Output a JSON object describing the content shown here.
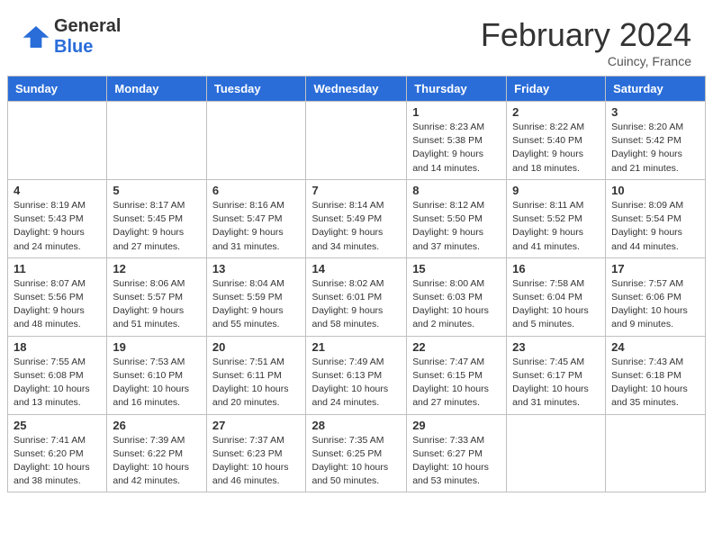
{
  "header": {
    "logo_general": "General",
    "logo_blue": "Blue",
    "month_year": "February 2024",
    "location": "Cuincy, France"
  },
  "weekdays": [
    "Sunday",
    "Monday",
    "Tuesday",
    "Wednesday",
    "Thursday",
    "Friday",
    "Saturday"
  ],
  "weeks": [
    [
      {
        "day": "",
        "info": ""
      },
      {
        "day": "",
        "info": ""
      },
      {
        "day": "",
        "info": ""
      },
      {
        "day": "",
        "info": ""
      },
      {
        "day": "1",
        "info": "Sunrise: 8:23 AM\nSunset: 5:38 PM\nDaylight: 9 hours\nand 14 minutes."
      },
      {
        "day": "2",
        "info": "Sunrise: 8:22 AM\nSunset: 5:40 PM\nDaylight: 9 hours\nand 18 minutes."
      },
      {
        "day": "3",
        "info": "Sunrise: 8:20 AM\nSunset: 5:42 PM\nDaylight: 9 hours\nand 21 minutes."
      }
    ],
    [
      {
        "day": "4",
        "info": "Sunrise: 8:19 AM\nSunset: 5:43 PM\nDaylight: 9 hours\nand 24 minutes."
      },
      {
        "day": "5",
        "info": "Sunrise: 8:17 AM\nSunset: 5:45 PM\nDaylight: 9 hours\nand 27 minutes."
      },
      {
        "day": "6",
        "info": "Sunrise: 8:16 AM\nSunset: 5:47 PM\nDaylight: 9 hours\nand 31 minutes."
      },
      {
        "day": "7",
        "info": "Sunrise: 8:14 AM\nSunset: 5:49 PM\nDaylight: 9 hours\nand 34 minutes."
      },
      {
        "day": "8",
        "info": "Sunrise: 8:12 AM\nSunset: 5:50 PM\nDaylight: 9 hours\nand 37 minutes."
      },
      {
        "day": "9",
        "info": "Sunrise: 8:11 AM\nSunset: 5:52 PM\nDaylight: 9 hours\nand 41 minutes."
      },
      {
        "day": "10",
        "info": "Sunrise: 8:09 AM\nSunset: 5:54 PM\nDaylight: 9 hours\nand 44 minutes."
      }
    ],
    [
      {
        "day": "11",
        "info": "Sunrise: 8:07 AM\nSunset: 5:56 PM\nDaylight: 9 hours\nand 48 minutes."
      },
      {
        "day": "12",
        "info": "Sunrise: 8:06 AM\nSunset: 5:57 PM\nDaylight: 9 hours\nand 51 minutes."
      },
      {
        "day": "13",
        "info": "Sunrise: 8:04 AM\nSunset: 5:59 PM\nDaylight: 9 hours\nand 55 minutes."
      },
      {
        "day": "14",
        "info": "Sunrise: 8:02 AM\nSunset: 6:01 PM\nDaylight: 9 hours\nand 58 minutes."
      },
      {
        "day": "15",
        "info": "Sunrise: 8:00 AM\nSunset: 6:03 PM\nDaylight: 10 hours\nand 2 minutes."
      },
      {
        "day": "16",
        "info": "Sunrise: 7:58 AM\nSunset: 6:04 PM\nDaylight: 10 hours\nand 5 minutes."
      },
      {
        "day": "17",
        "info": "Sunrise: 7:57 AM\nSunset: 6:06 PM\nDaylight: 10 hours\nand 9 minutes."
      }
    ],
    [
      {
        "day": "18",
        "info": "Sunrise: 7:55 AM\nSunset: 6:08 PM\nDaylight: 10 hours\nand 13 minutes."
      },
      {
        "day": "19",
        "info": "Sunrise: 7:53 AM\nSunset: 6:10 PM\nDaylight: 10 hours\nand 16 minutes."
      },
      {
        "day": "20",
        "info": "Sunrise: 7:51 AM\nSunset: 6:11 PM\nDaylight: 10 hours\nand 20 minutes."
      },
      {
        "day": "21",
        "info": "Sunrise: 7:49 AM\nSunset: 6:13 PM\nDaylight: 10 hours\nand 24 minutes."
      },
      {
        "day": "22",
        "info": "Sunrise: 7:47 AM\nSunset: 6:15 PM\nDaylight: 10 hours\nand 27 minutes."
      },
      {
        "day": "23",
        "info": "Sunrise: 7:45 AM\nSunset: 6:17 PM\nDaylight: 10 hours\nand 31 minutes."
      },
      {
        "day": "24",
        "info": "Sunrise: 7:43 AM\nSunset: 6:18 PM\nDaylight: 10 hours\nand 35 minutes."
      }
    ],
    [
      {
        "day": "25",
        "info": "Sunrise: 7:41 AM\nSunset: 6:20 PM\nDaylight: 10 hours\nand 38 minutes."
      },
      {
        "day": "26",
        "info": "Sunrise: 7:39 AM\nSunset: 6:22 PM\nDaylight: 10 hours\nand 42 minutes."
      },
      {
        "day": "27",
        "info": "Sunrise: 7:37 AM\nSunset: 6:23 PM\nDaylight: 10 hours\nand 46 minutes."
      },
      {
        "day": "28",
        "info": "Sunrise: 7:35 AM\nSunset: 6:25 PM\nDaylight: 10 hours\nand 50 minutes."
      },
      {
        "day": "29",
        "info": "Sunrise: 7:33 AM\nSunset: 6:27 PM\nDaylight: 10 hours\nand 53 minutes."
      },
      {
        "day": "",
        "info": ""
      },
      {
        "day": "",
        "info": ""
      }
    ]
  ]
}
